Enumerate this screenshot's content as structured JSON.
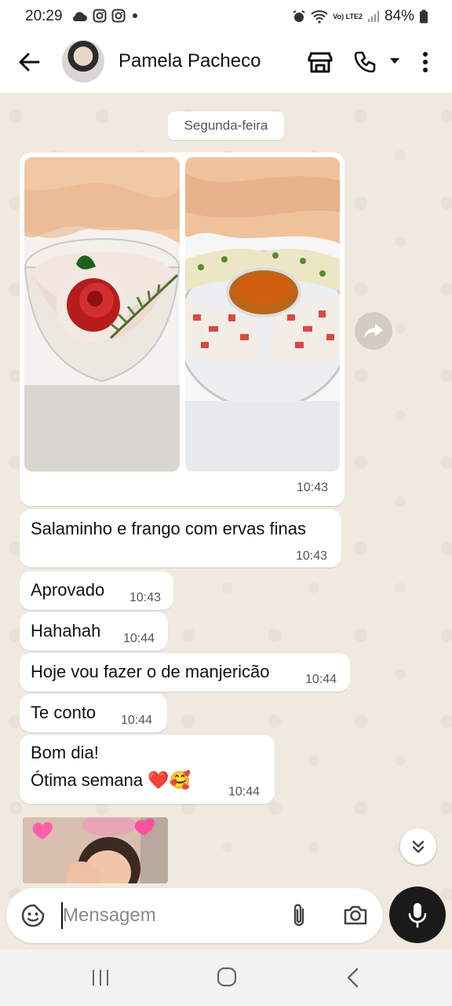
{
  "status_bar": {
    "time": "20:29",
    "network_label": "Vo) LTE2",
    "battery": "84%"
  },
  "header": {
    "contact_name": "Pamela Pacheco"
  },
  "chat": {
    "date_label": "Segunda-feira",
    "image_message": {
      "time": "10:43"
    },
    "messages": [
      {
        "text": "Salaminho e frango com ervas finas",
        "time": "10:43"
      },
      {
        "text": "Aprovado",
        "time": "10:43"
      },
      {
        "text": "Hahahah",
        "time": "10:44"
      },
      {
        "text": "Hoje vou fazer o de manjericão",
        "time": "10:44"
      },
      {
        "text": "Te conto",
        "time": "10:44"
      },
      {
        "line1": "Bom dia!",
        "line2": "Ótima semana ❤️🥰",
        "time": "10:44"
      }
    ]
  },
  "composer": {
    "placeholder": "Mensagem"
  },
  "colors": {
    "chat_background": "#efe9df",
    "bubble": "#ffffff",
    "mic_button": "#1a1a1a"
  }
}
